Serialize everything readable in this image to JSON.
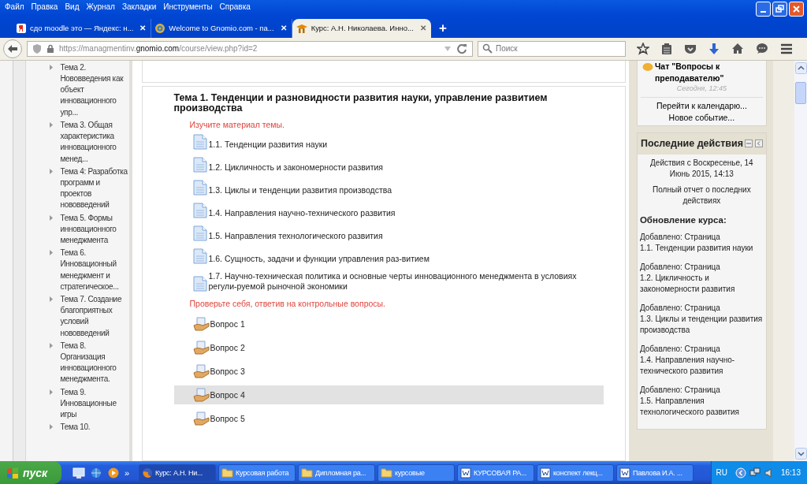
{
  "menu": [
    "Файл",
    "Правка",
    "Вид",
    "Журнал",
    "Закладки",
    "Инструменты",
    "Справка"
  ],
  "tabs": [
    {
      "label": "сдо moodle это — Яндекс: н...",
      "kind": "red",
      "selected": false,
      "close": "✕"
    },
    {
      "label": "Welcome to Gnomio.com - па...",
      "kind": "ring",
      "selected": false,
      "close": "✕"
    },
    {
      "label": "Курс: А.Н. Николаева. Инно...",
      "kind": "cap",
      "selected": true,
      "close": "✕"
    }
  ],
  "new_tab": "+",
  "address": {
    "prefix": "https://managmentinv.",
    "domain": "gnomio.com",
    "path": "/course/view.php?id=2"
  },
  "search": {
    "placeholder": "Поиск"
  },
  "sidebar": {
    "items": [
      "Тема 2. Нововведения как объект инновационного упр...",
      "Тема 3. Общая характеристика инновационного менед...",
      "Тема 4: Разработка программ и проектов нововведений",
      "Тема 5. Формы инновационного менеджмента",
      "Тема 6. Инновационный менеджмент и стратегическое...",
      "Тема 7. Создание благоприятных условий нововведений",
      "Тема 8. Организация инновационного менеджмента.",
      "Тема 9. Инновационные игры",
      "Тема 10."
    ]
  },
  "topic": {
    "title": "Тема 1. Тенденции и разновидности развития науки, управление развитием производства",
    "intro": "Изучите материал темы.",
    "pages": [
      "1.1. Тенденции развития науки",
      "1.2. Цикличность и закономерности развития",
      "1.3. Циклы и тенденции развития производства",
      "1.4. Направления научно-технического развития",
      "1.5. Направления технологического развития",
      "1.6. Сущность, задачи и функции управления раз-витием",
      "1.7. Научно-техническая политика и основные черты инновационного менеджмента в условиях регули-руемой рыночной экономики"
    ],
    "quiz_intro": "Проверьте себя, ответив на контрольные вопросы.",
    "quizzes": [
      {
        "label": "Вопрос 1",
        "highlighted": false
      },
      {
        "label": "Вопрос 2",
        "highlighted": false
      },
      {
        "label": "Вопрос 3",
        "highlighted": false
      },
      {
        "label": "Вопрос 4",
        "highlighted": true
      },
      {
        "label": "Вопрос 5",
        "highlighted": false
      }
    ]
  },
  "calendar": {
    "event": "Чат \"Вопросы к преподавателю\"",
    "time": "Сегодня, 12:45",
    "links": [
      "Перейти к календарю...",
      "Новое событие..."
    ]
  },
  "recent": {
    "title": "Последние действия",
    "since": "Действия с Воскресенье, 14 Июнь 2015, 14:13",
    "report": "Полный отчет о последних действиях",
    "updates_heading": "Обновление курса:",
    "updates": [
      {
        "action": "Добавлено: Страница",
        "name": "1.1. Тенденции развития науки"
      },
      {
        "action": "Добавлено: Страница",
        "name": "1.2. Цикличность и закономерности развития"
      },
      {
        "action": "Добавлено: Страница",
        "name": "1.3. Циклы и тенденции развития производства"
      },
      {
        "action": "Добавлено: Страница",
        "name": "1.4. Направления научно-технического развития"
      },
      {
        "action": "Добавлено: Страница",
        "name": "1.5. Направления технологического развития"
      }
    ]
  },
  "taskbar": {
    "start": "пуск",
    "more": "»",
    "items": [
      {
        "label": "Курс: А.Н. Ни...",
        "kind": "browser",
        "selected": true
      },
      {
        "label": "Курсовая работа",
        "kind": "folder",
        "selected": false
      },
      {
        "label": "Дипломная ра...",
        "kind": "folder",
        "selected": false
      },
      {
        "label": "курсовые",
        "kind": "folder",
        "selected": false
      },
      {
        "label": "КУРСОВАЯ РА...",
        "kind": "document",
        "selected": false
      },
      {
        "label": "конспект лекц...",
        "kind": "document",
        "selected": false
      },
      {
        "label": "Павлова И.А. ...",
        "kind": "document",
        "selected": false
      }
    ],
    "language": "RU",
    "clock": "16:13"
  }
}
